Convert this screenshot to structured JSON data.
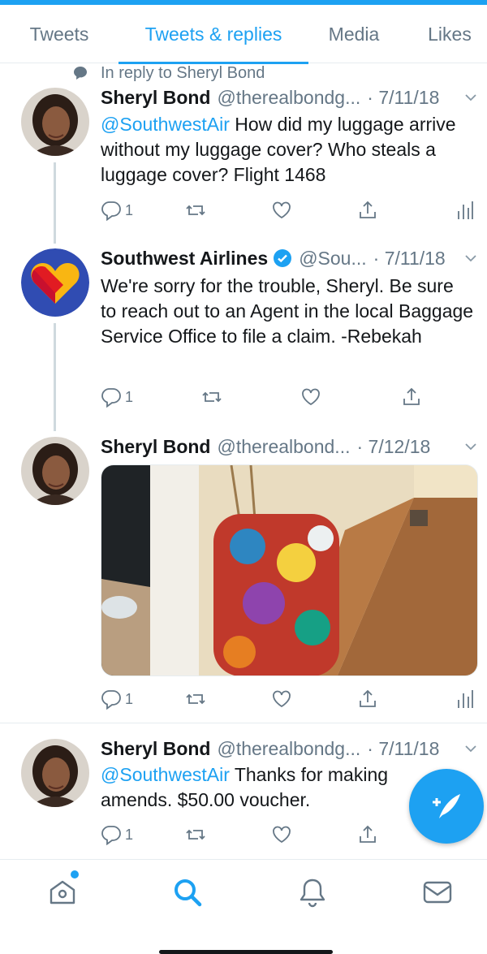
{
  "tabs": [
    {
      "label": "Tweets",
      "active": false
    },
    {
      "label": "Tweets & replies",
      "active": true
    },
    {
      "label": "Media",
      "active": false
    },
    {
      "label": "Likes",
      "active": false
    }
  ],
  "reply_context": "In reply to Sheryl Bond",
  "tweets": [
    {
      "name": "Sheryl Bond",
      "handle": "@therealbondg...",
      "date": "· 7/11/18",
      "mention": "@SouthwestAir",
      "text": " How did my luggage arrive without my luggage cover? Who steals a luggage cover? Flight 1468",
      "reply_count": "1"
    },
    {
      "name": "Southwest Airlines",
      "verified": true,
      "handle": "@Sou...",
      "date": "· 7/11/18",
      "text": "We're sorry for the trouble, Sheryl. Be sure to reach out to an Agent in the local Baggage Service Office to file a claim. -Rebekah",
      "reply_count": "1"
    },
    {
      "name": "Sheryl Bond",
      "handle": "@therealbond...",
      "date": "· 7/12/18",
      "has_photo": true,
      "reply_count": "1"
    },
    {
      "name": "Sheryl Bond",
      "handle": "@therealbondg...",
      "date": "· 7/11/18",
      "mention": "@SouthwestAir",
      "text": " Thanks for making amends. $50.00 voucher.",
      "reply_count": "1"
    }
  ],
  "colors": {
    "accent": "#1da1f2",
    "text": "#14171a",
    "muted": "#657786",
    "border": "#e6ecf0"
  },
  "icons": [
    "reply-icon",
    "retweet-icon",
    "like-icon",
    "share-icon",
    "analytics-icon",
    "home-icon",
    "search-icon",
    "notifications-icon",
    "messages-icon",
    "compose-icon",
    "chevron-down-icon",
    "verified-icon"
  ]
}
